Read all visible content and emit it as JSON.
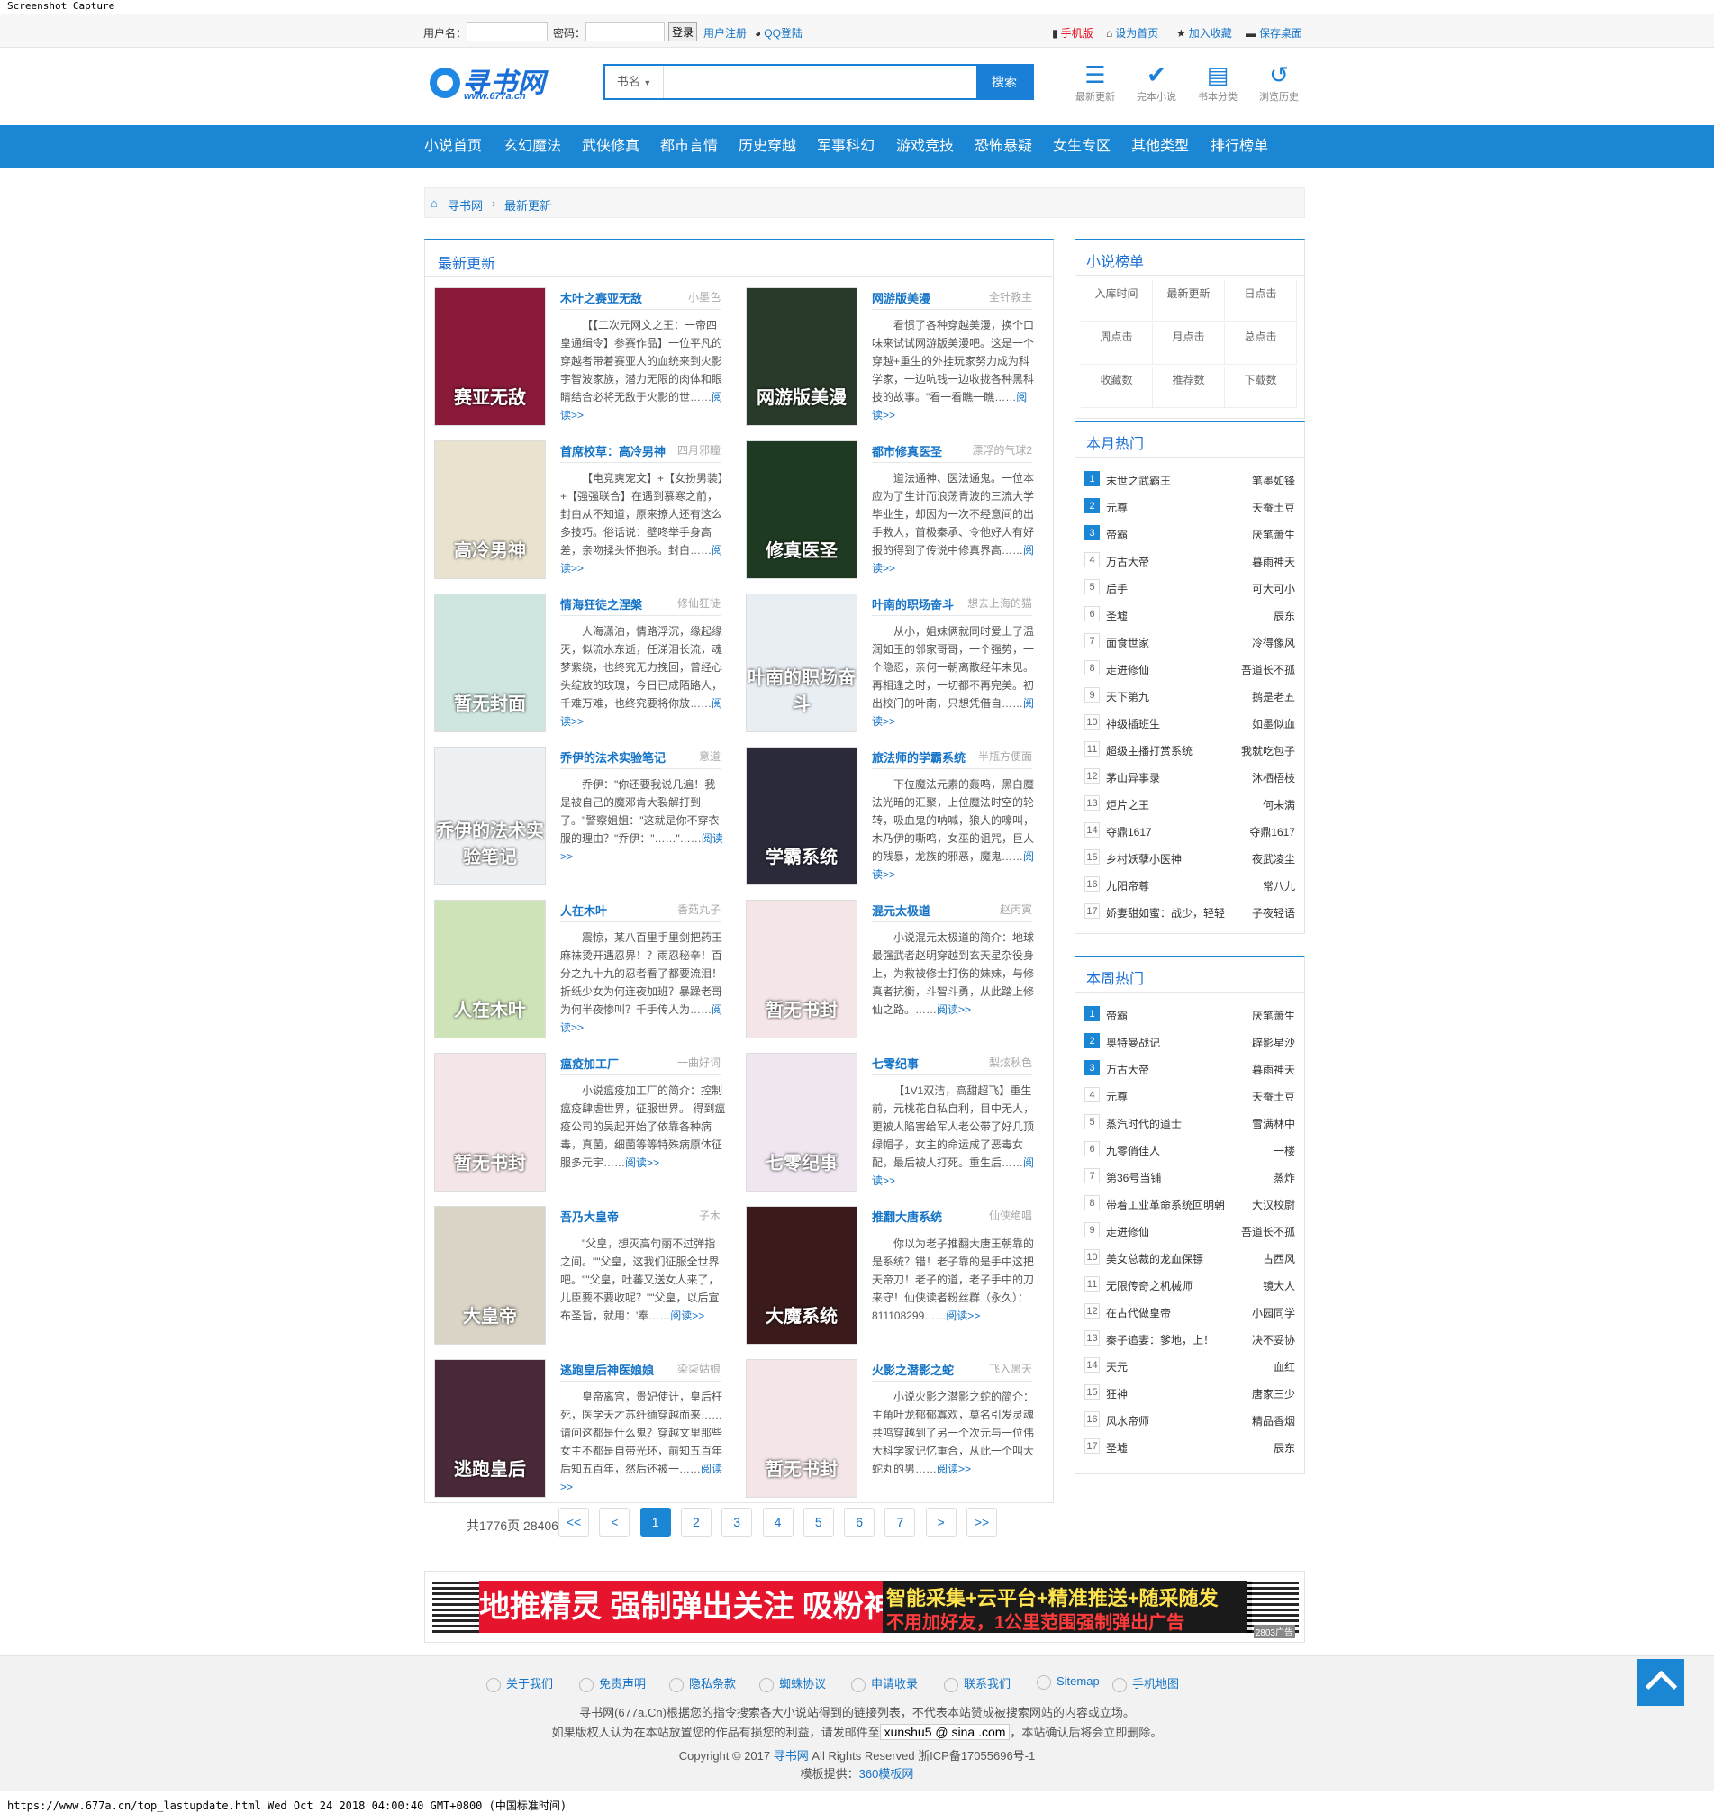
{
  "capture": {
    "title": "Screenshot Capture",
    "status": "https://www.677a.cn/top_lastupdate.html Wed Oct 24 2018 04:00:40 GMT+0800 (中国标准时间)"
  },
  "topbar": {
    "username_label": "用户名：",
    "password_label": "密码：",
    "login_button": "登录",
    "register": "用户注册",
    "qq_login": "QQ登陆",
    "mobile": "手机版",
    "homepage": "设为首页",
    "favorite": "加入收藏",
    "desktop": "保存桌面"
  },
  "logo": {
    "name": "寻书网",
    "url": "www.677a.cn"
  },
  "search": {
    "category": "书名",
    "placeholder": "",
    "button": "搜索"
  },
  "header_nav": [
    {
      "label": "最新更新",
      "icon": "list-icon"
    },
    {
      "label": "完本小说",
      "icon": "check-circle-icon"
    },
    {
      "label": "书本分类",
      "icon": "book-icon"
    },
    {
      "label": "浏览历史",
      "icon": "history-icon"
    }
  ],
  "main_nav": [
    "小说首页",
    "玄幻魔法",
    "武侠修真",
    "都市言情",
    "历史穿越",
    "军事科幻",
    "游戏竞技",
    "恐怖悬疑",
    "女生专区",
    "其他类型",
    "排行榜单"
  ],
  "breadcrumb": {
    "home": "寻书网",
    "sep": "›",
    "current": "最新更新"
  },
  "latest": {
    "title": "最新更新",
    "more": "阅读>>",
    "books": [
      {
        "title": "木叶之赛亚无敌",
        "author": "小墨色",
        "cover_text": "赛亚无敌",
        "cover_color": "#8a1a3a",
        "desc": "【【二次元网文之王：一帝四皇通缉令】参赛作品】一位平凡的穿越者带着赛亚人的血统来到火影宇智波家族，潜力无限的肉体和眼睛结合必将无敌于火影的世……"
      },
      {
        "title": "网游版美漫",
        "author": "全针教主",
        "cover_text": "网游版美漫",
        "cover_color": "#2a3a2a",
        "desc": "看惯了各种穿越美漫，换个口味来试试网游版美漫吧。这是一个穿越+重生的外挂玩家努力成为科学家，一边吭钱一边收拢各种黑科技的故事。\"看一看瞧一瞧……"
      },
      {
        "title": "首席校草：高冷男神",
        "author": "四月邪瞳",
        "cover_text": "高冷男神",
        "cover_color": "#e8e2cf",
        "desc": "【电竞爽宠文】+【女扮男装】+【强强联合】在遇到慕寒之前，封白从不知道，原来撩人还有这么多技巧。俗话说：壁咚举手身高差，亲吻揉头怀抱杀。封白……"
      },
      {
        "title": "都市修真医圣",
        "author": "漂浮的气球2",
        "cover_text": "修真医圣",
        "cover_color": "#1f3a22",
        "desc": "道法通神、医法通鬼。一位本应为了生计而浪荡青波的三流大学毕业生，却因为一次不经意间的出手救人，首极秦承、令他好人有好报的得到了传说中修真界高……"
      },
      {
        "title": "情海狂徒之涅槃",
        "author": "修仙狂徒",
        "cover_text": "暂无封面",
        "cover_color": "#cfe6e0",
        "desc": "人海潇泊，情路浮沉，缘起缘灭，似流水东逝，任涕泪长流，魂梦紫绕，也终究无力挽回，曾经心头绽放的玫瑰，今日已成陌路人，千难万难，也终究要将你放……"
      },
      {
        "title": "叶南的职场奋斗",
        "author": "想去上海的猫",
        "cover_text": "叶南的职场奋斗",
        "cover_color": "#e9eef3",
        "desc": "从小，姐妹俩就同时爱上了温润如玉的邻家哥哥，一个强势，一个隐忍，亲何一朝离散经年未见。再相逢之时，一切都不再完美。初出校门的叶南，只想凭借自……"
      },
      {
        "title": "乔伊的法术实验笔记",
        "author": "意道",
        "cover_text": "乔伊的法术实验笔记",
        "cover_color": "#eef1f3",
        "desc": "乔伊：\"你还要我说几遍！我是被自己的魔邓肯大裂解打到了。\"警察姐姐：\"这就是你不穿衣服的理由？\"乔伊：\"……\"……"
      },
      {
        "title": "旅法师的学霸系统",
        "author": "半瓶方便面",
        "cover_text": "学霸系统",
        "cover_color": "#2a2a3a",
        "desc": "下位魔法元素的轰鸣，黑白魔法光暗的汇聚，上位魔法时空的轮转，吸血鬼的呐喊，狼人的嚎叫，木乃伊的嘶鸣，女巫的诅咒，巨人的残暴，龙族的邪恶，魔鬼……"
      },
      {
        "title": "人在木叶",
        "author": "香菇丸子",
        "cover_text": "人在木叶",
        "cover_color": "#cfe3b8",
        "desc": "震惊，某八百里手里剑把药王麻袜烫开遇忍界！？雨忍秘辛！百分之九十九的忍者看了都要流泪！折纸少女为何连夜加班？暴躁老哥为何半夜惨叫？千手传人为……"
      },
      {
        "title": "混元太极道",
        "author": "赵丙寅",
        "cover_text": "暂无书封",
        "cover_color": "#f4e6e6",
        "desc": "小说混元太极道的简介：地球最强武者赵明穿越到玄天星杂役身上，为救被修士打伤的妹妹，与修真者抗衡，斗智斗勇，从此踏上修仙之路。……"
      },
      {
        "title": "瘟疫加工厂",
        "author": "一曲好词",
        "cover_text": "暂无书封",
        "cover_color": "#f4e6e6",
        "desc": "小说瘟疫加工厂的简介：控制瘟疫肆虐世界，征服世界。 得到瘟疫公司的吴起开始了依靠各种病毒，真菌，细菌等等特殊病原体征服多元宇……"
      },
      {
        "title": "七零纪事",
        "author": "梨炫秋色",
        "cover_text": "七零纪事",
        "cover_color": "#efe6ef",
        "desc": "【1V1双洁，高甜超飞】重生前，元桃花自私自利，目中无人，更被人陷害给军人老公带了好几顶绿帽子，女主的命运成了恶毒女配，最后被人打死。重生后……"
      },
      {
        "title": "吾乃大皇帝",
        "author": "子木",
        "cover_text": "大皇帝",
        "cover_color": "#d9d4c6",
        "desc": "\"父皇，想灭高句丽不过弹指之间。\"\"父皇，这我们征服全世界吧。\"\"父皇，吐蕃又送女人来了，儿臣要不要收呢？\"\"父皇，以后宣布圣旨，就用：'奉……"
      },
      {
        "title": "推翻大唐系统",
        "author": "仙侠绝唱",
        "cover_text": "大魔系统",
        "cover_color": "#3a1a1a",
        "desc": "你以为老子推翻大唐王朝靠的是系统？错！老子靠的是手中这把天帝刀！老子的道，老子手中的刀来守！仙侠读者粉丝群（永久）：811108299……"
      },
      {
        "title": "逃跑皇后神医娘娘",
        "author": "染柒姑娘",
        "cover_text": "逃跑皇后",
        "cover_color": "#4a2a3a",
        "desc": "皇帝离宫，贵妃使计，皇后枉死，医学天才苏纤缅穿越而来……请问这都是什么鬼？穿越文里那些女主不都是自带光环，前知五百年后知五百年，然后还被一……"
      },
      {
        "title": "火影之潜影之蛇",
        "author": "飞入黑天",
        "cover_text": "暂无书封",
        "cover_color": "#f4e6e6",
        "desc": "小说火影之潜影之蛇的简介：主角叶龙郁郁寡欢，莫名引发灵魂共鸣穿越到了另一个次元与一位伟大科学家记忆重合，从此一个叫大蛇丸的男……"
      }
    ]
  },
  "pager": {
    "total": "共1776页 28406条",
    "buttons": [
      "<<",
      "<",
      "1",
      "2",
      "3",
      "4",
      "5",
      "6",
      "7",
      ">",
      ">>"
    ],
    "active": "1"
  },
  "rank_panel": {
    "title": "小说榜单",
    "tabs": [
      "入库时间",
      "最新更新",
      "日点击",
      "周点击",
      "月点击",
      "总点击",
      "收藏数",
      "推荐数",
      "下载数"
    ]
  },
  "monthly_hot": {
    "title": "本月热门",
    "items": [
      {
        "name": "末世之武霸王",
        "author": "笔墨如锋"
      },
      {
        "name": "元尊",
        "author": "天蚕土豆"
      },
      {
        "name": "帝霸",
        "author": "厌笔萧生"
      },
      {
        "name": "万古大帝",
        "author": "暮雨神天"
      },
      {
        "name": "后手",
        "author": "可大可小"
      },
      {
        "name": "圣墟",
        "author": "辰东"
      },
      {
        "name": "面食世家",
        "author": "冷得像风"
      },
      {
        "name": "走进修仙",
        "author": "吾道长不孤"
      },
      {
        "name": "天下第九",
        "author": "鹅是老五"
      },
      {
        "name": "神级插班生",
        "author": "如墨似血"
      },
      {
        "name": "超级主播打赏系统",
        "author": "我就吃包子"
      },
      {
        "name": "茅山异事录",
        "author": "沐栖梧枝"
      },
      {
        "name": "炬片之王",
        "author": "何未满"
      },
      {
        "name": "夺鼎1617",
        "author": "夺鼎1617"
      },
      {
        "name": "乡村妖孽小医神",
        "author": "夜武凌尘"
      },
      {
        "name": "九阳帝尊",
        "author": "常八九"
      },
      {
        "name": "娇妻甜如蜜：战少，轻轻",
        "author": "子夜轻语"
      }
    ]
  },
  "weekly_hot": {
    "title": "本周热门",
    "items": [
      {
        "name": "帝霸",
        "author": "厌笔萧生"
      },
      {
        "name": "奥特曼战记",
        "author": "辟影星沙"
      },
      {
        "name": "万古大帝",
        "author": "暮雨神天"
      },
      {
        "name": "元尊",
        "author": "天蚕土豆"
      },
      {
        "name": "蒸汽时代的道士",
        "author": "雪满林中"
      },
      {
        "name": "九零俏佳人",
        "author": "一楼"
      },
      {
        "name": "第36号当铺",
        "author": "蒸炸"
      },
      {
        "name": "带着工业革命系统回明朝",
        "author": "大汉校尉"
      },
      {
        "name": "走进修仙",
        "author": "吾道长不孤"
      },
      {
        "name": "美女总裁的龙血保镖",
        "author": "古西风"
      },
      {
        "name": "无限传奇之机械师",
        "author": "镜大人"
      },
      {
        "name": "在古代做皇帝",
        "author": "小园同学"
      },
      {
        "name": "秦子追妻：爹地，上！",
        "author": "决不妥协"
      },
      {
        "name": "天元",
        "author": "血红"
      },
      {
        "name": "狂神",
        "author": "唐家三少"
      },
      {
        "name": "风水帝师",
        "author": "精品香烟"
      },
      {
        "name": "圣墟",
        "author": "辰东"
      }
    ]
  },
  "ad": {
    "main": "地推精灵 强制弹出关注 吸粉神器",
    "line1": "智能采集+云平台+精准推送+随采随发",
    "line2": "不用加好友，1公里范围强制弹出广告",
    "tag": "2803广告"
  },
  "footer": {
    "links": [
      "关于我们",
      "免责声明",
      "隐私条款",
      "蜘蛛协议",
      "申请收录",
      "联系我们",
      "Sitemap",
      "手机地图"
    ],
    "line1": "寻书网(677a.Cn)根据您的指令搜索各大小说站得到的链接列表，不代表本站赞成被搜索网站的内容或立场。",
    "line2a": "如果版权人认为在本站放置您的作品有损您的利益，请发邮件至",
    "email": "xunshu5 @ sina .com",
    "line2b": "，本站确认后将会立即删除。",
    "line3a": "Copyright © 2017",
    "line3link": "寻书网",
    "line3b": "All Rights Reserved 浙ICP备17055696号-1",
    "line4a": "模板提供：",
    "line4link": "360模板网"
  },
  "colors": {
    "accent": "#1a86d4",
    "link": "#1574c7",
    "ad_red": "#e6142d"
  }
}
